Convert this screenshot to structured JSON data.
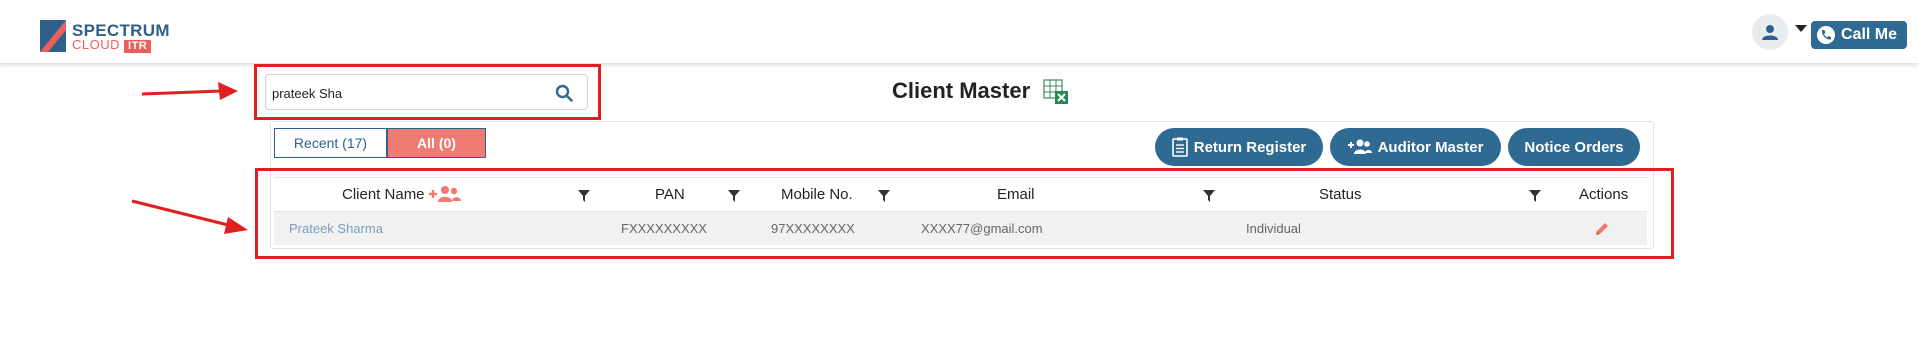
{
  "header": {
    "logo_top": "SPECTRUM",
    "logo_bottom": "CLOUD",
    "logo_badge": "ITR",
    "call_label": "Call Me"
  },
  "search": {
    "value": "prateek Sha"
  },
  "page_title": "Client Master",
  "tabs": [
    {
      "label": "Recent (17)",
      "active": false
    },
    {
      "label": "All (0)",
      "active": true
    }
  ],
  "actions": {
    "return_register": "Return Register",
    "auditor_master": "Auditor Master",
    "notice_orders": "Notice Orders"
  },
  "table": {
    "headers": {
      "client_name": "Client Name",
      "pan": "PAN",
      "mobile": "Mobile No.",
      "email": "Email",
      "status": "Status",
      "actions": "Actions"
    },
    "rows": [
      {
        "client_name": "Prateek Sharma",
        "pan": "FXXXXXXXXX",
        "mobile": "97XXXXXXXX",
        "email": "XXXX77@gmail.com",
        "status": "Individual"
      }
    ]
  },
  "colors": {
    "primary": "#2f6a93",
    "accent": "#f07b72",
    "annotation": "#e02020"
  }
}
